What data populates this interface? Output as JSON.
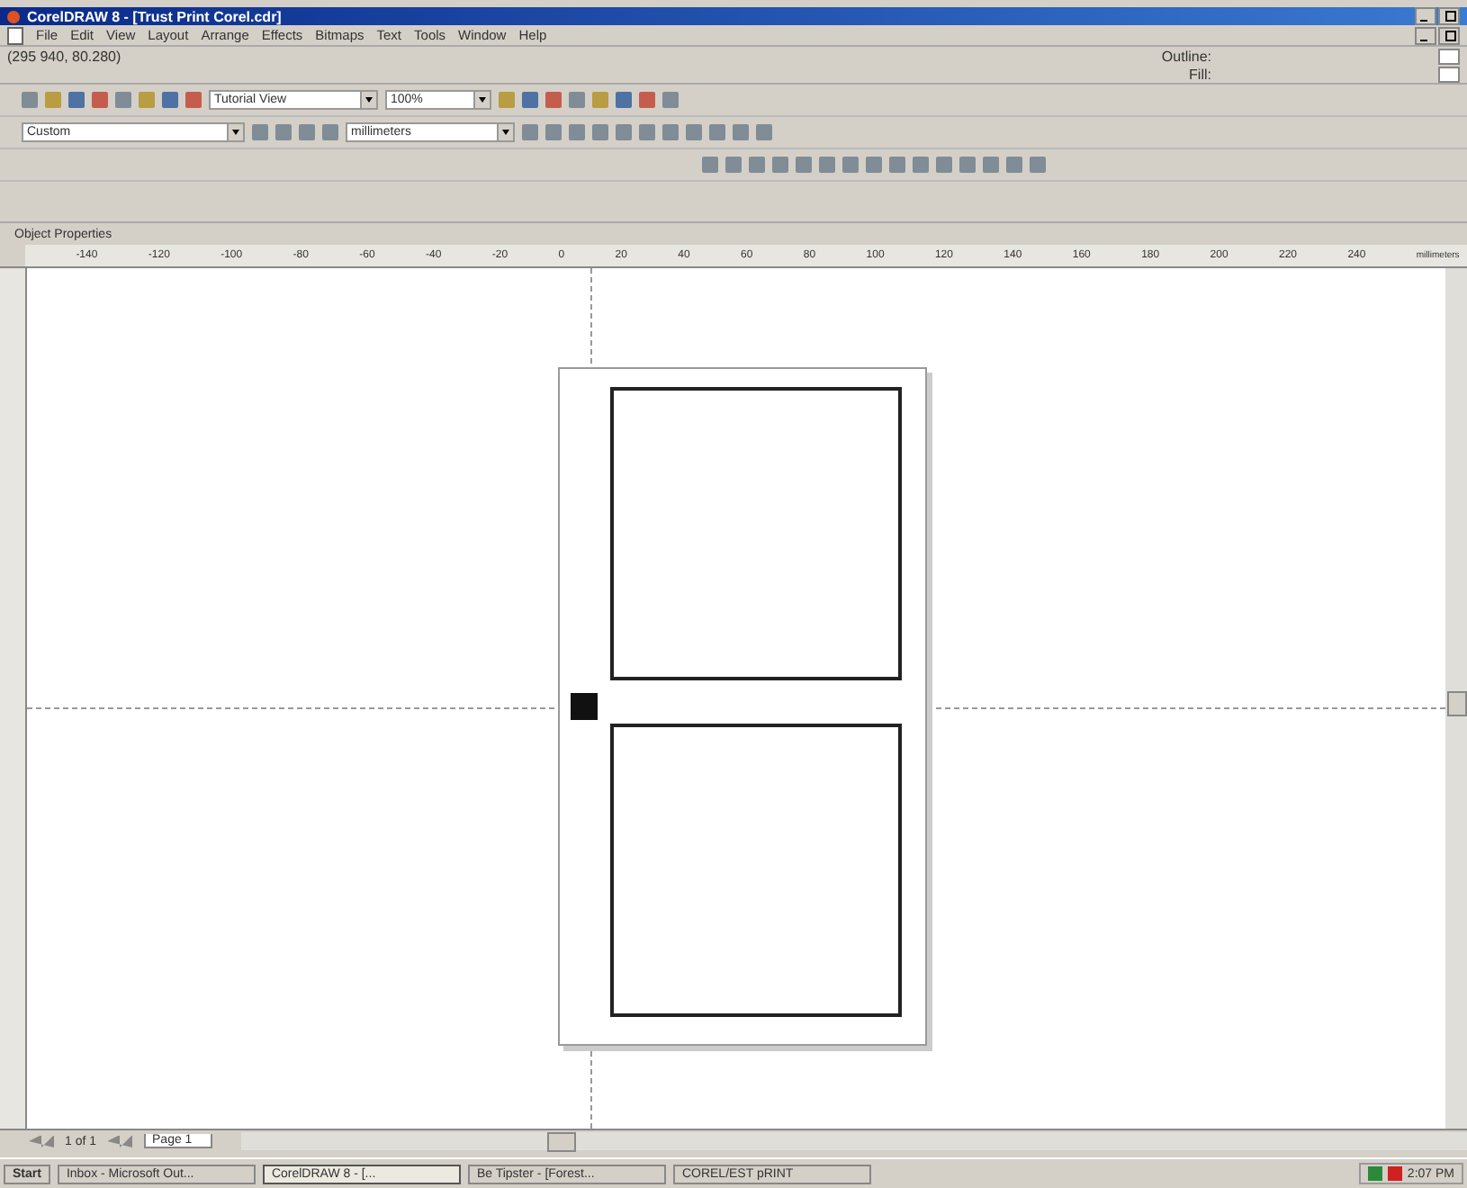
{
  "window": {
    "title": "CorelDRAW 8 - [Trust Print Corel.cdr]"
  },
  "menu": [
    "File",
    "Edit",
    "View",
    "Layout",
    "Arrange",
    "Effects",
    "Bitmaps",
    "Text",
    "Tools",
    "Window",
    "Help"
  ],
  "status": {
    "coordinates": "(295 940, 80.280)",
    "outline": "Outline:",
    "fill": "Fill:"
  },
  "toolbar": {
    "view": "Tutorial View",
    "zoom": "100%"
  },
  "property_bar": {
    "paper": "Custom",
    "units": "millimeters"
  },
  "docker": {
    "label": "Object Properties"
  },
  "ruler": {
    "ticks": [
      "-140",
      "-120",
      "-100",
      "-80",
      "-60",
      "-40",
      "-20",
      "0",
      "20",
      "40",
      "60",
      "80",
      "100",
      "120",
      "140",
      "160",
      "180",
      "200",
      "220",
      "240"
    ],
    "unit": "millimeters"
  },
  "pages": {
    "count": "1 of 1",
    "tabs": [
      {
        "label": "Page 1",
        "selected": true
      }
    ]
  },
  "taskbar": {
    "start": "Start",
    "items": [
      {
        "label": "Inbox - Microsoft Out...",
        "selected": false
      },
      {
        "label": "CorelDRAW 8 - [...",
        "selected": true
      },
      {
        "label": "Be Tipster - [Forest...",
        "selected": false
      },
      {
        "label": "COREL/EST pRINT",
        "selected": false
      }
    ],
    "clock": "2:07 PM"
  }
}
